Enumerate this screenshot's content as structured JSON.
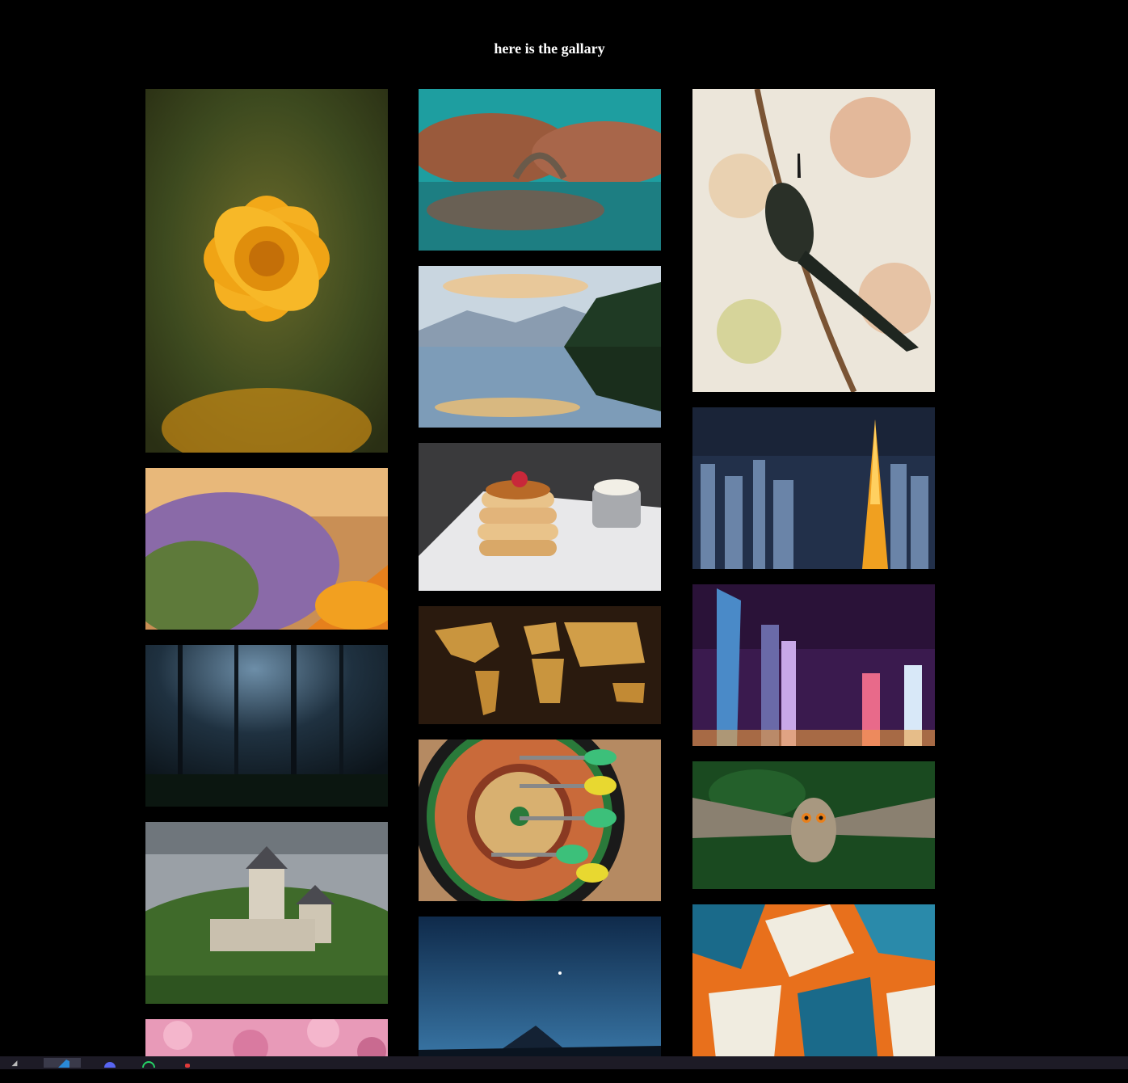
{
  "page": {
    "title": "here is the gallary"
  },
  "gallery": {
    "columns": [
      [
        {
          "name": "gallery-image-orange-flower",
          "height": 450
        },
        {
          "name": "gallery-image-lavender-field",
          "height": 200
        },
        {
          "name": "gallery-image-dark-forest",
          "height": 200
        },
        {
          "name": "gallery-image-castle",
          "height": 225
        },
        {
          "name": "gallery-image-cherry-blossom",
          "height": 60
        }
      ],
      [
        {
          "name": "gallery-image-lake-bridge",
          "height": 200
        },
        {
          "name": "gallery-image-mountain-lake",
          "height": 200
        },
        {
          "name": "gallery-image-pancakes",
          "height": 183
        },
        {
          "name": "gallery-image-world-map",
          "height": 146
        },
        {
          "name": "gallery-image-darts",
          "height": 200
        },
        {
          "name": "gallery-image-mount-fuji-night",
          "height": 180
        }
      ],
      [
        {
          "name": "gallery-image-hummingbird",
          "height": 375
        },
        {
          "name": "gallery-image-tokyo-tower",
          "height": 200
        },
        {
          "name": "gallery-image-shanghai-night",
          "height": 200
        },
        {
          "name": "gallery-image-flying-owl",
          "height": 158
        },
        {
          "name": "gallery-image-abstract-painting",
          "height": 200
        }
      ]
    ]
  },
  "taskbar": {
    "items": [
      "app-icon",
      "vscode-icon",
      "discord-icon",
      "whatsapp-icon",
      "app-icon-red"
    ]
  }
}
